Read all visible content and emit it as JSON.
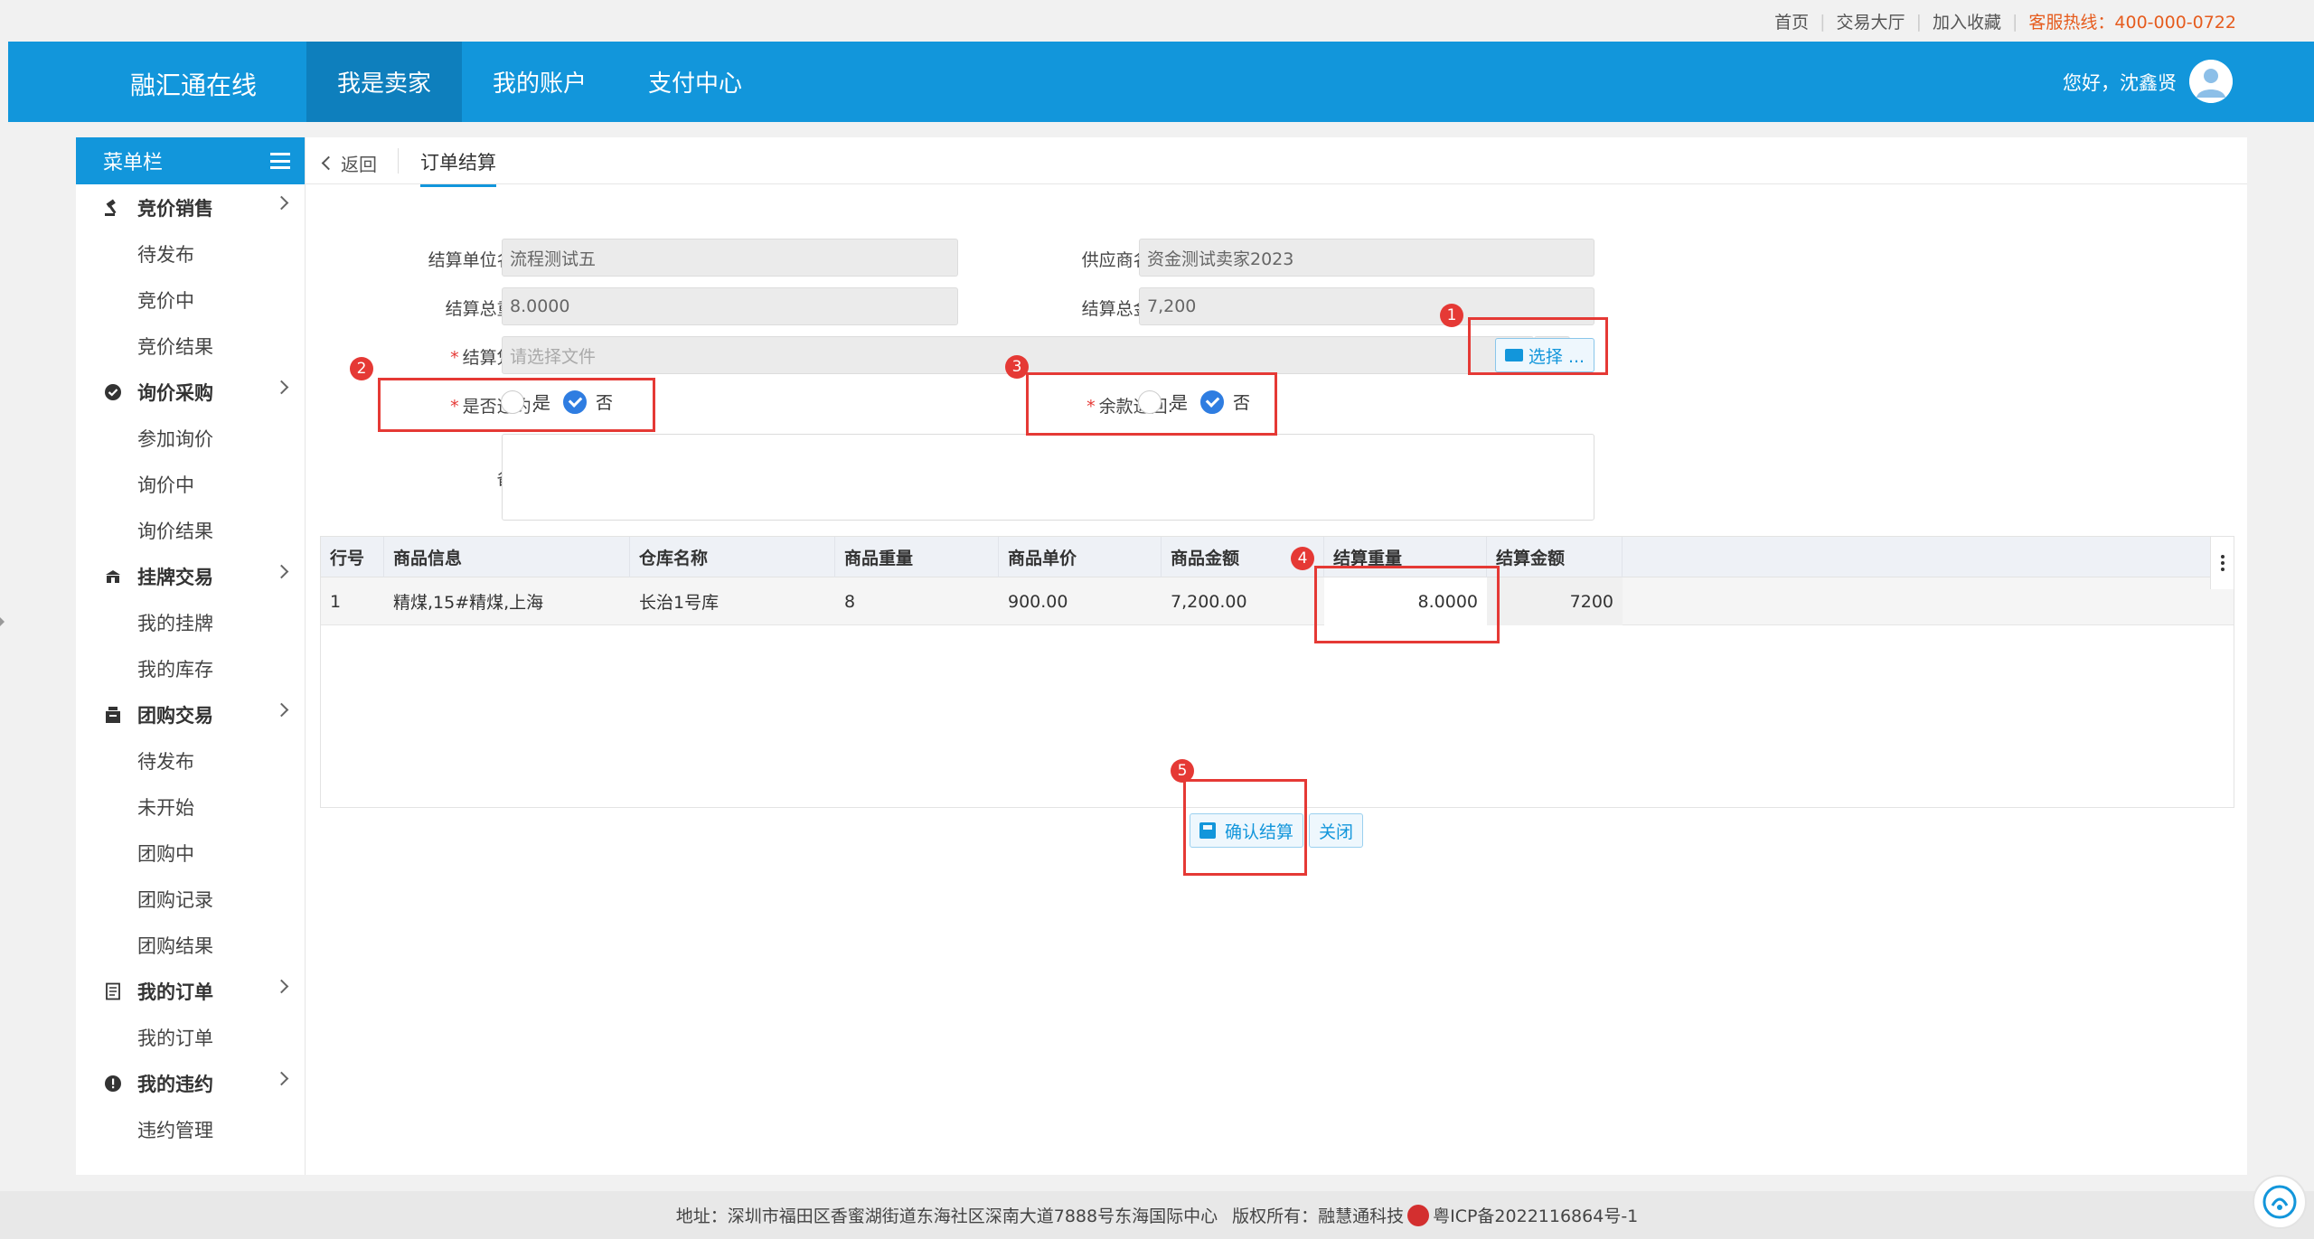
{
  "top_links": {
    "home": "首页",
    "hall": "交易大厅",
    "favorite": "加入收藏",
    "hotline": "客服热线：400-000-0722"
  },
  "header": {
    "brand": "融汇通在线",
    "tabs": [
      "我是卖家",
      "我的账户",
      "支付中心"
    ],
    "greeting": "您好，沈鑫贤"
  },
  "sidebar": {
    "title": "菜单栏",
    "groups": [
      {
        "label": "竞价销售",
        "icon": "gavel-icon",
        "items": [
          "待发布",
          "竞价中",
          "竞价结果"
        ]
      },
      {
        "label": "询价采购",
        "icon": "check-circle-icon",
        "items": [
          "参加询价",
          "询价中",
          "询价结果"
        ]
      },
      {
        "label": "挂牌交易",
        "icon": "listing-icon",
        "items": [
          "我的挂牌",
          "我的库存"
        ]
      },
      {
        "label": "团购交易",
        "icon": "group-buy-icon",
        "items": [
          "待发布",
          "未开始",
          "团购中",
          "团购记录",
          "团购结果"
        ]
      },
      {
        "label": "我的订单",
        "icon": "order-icon",
        "items": [
          "我的订单"
        ]
      },
      {
        "label": "我的违约",
        "icon": "alert-icon",
        "items": [
          "违约管理"
        ]
      }
    ]
  },
  "breadcrumb": {
    "back": "返回",
    "current": "订单结算"
  },
  "form": {
    "unit_name_label": "结算单位名称:",
    "unit_name_value": "流程测试五",
    "supplier_label": "供应商名称:",
    "supplier_value": "资金测试卖家2023",
    "total_weight_label": "结算总重量:",
    "total_weight_value": "8.0000",
    "total_amount_label": "结算总金额:",
    "total_amount_value": "7,200",
    "voucher_label": "结算凭证:",
    "voucher_placeholder": "请选择文件",
    "choose_button": "选择 ...",
    "breach_label": "是否违约:",
    "refund_label": "余款退回:",
    "yes": "是",
    "no": "否",
    "remark_label": "备注:"
  },
  "table": {
    "columns": [
      "行号",
      "商品信息",
      "仓库名称",
      "商品重量",
      "商品单价",
      "商品金额",
      "结算重量",
      "结算金额"
    ],
    "rows": [
      [
        "1",
        "精煤,15#精煤,上海",
        "长治1号库",
        "8",
        "900.00",
        "7,200.00",
        "8.0000",
        "7200"
      ]
    ]
  },
  "actions": {
    "confirm": "确认结算",
    "close": "关闭"
  },
  "annotations": [
    "1",
    "2",
    "3",
    "4",
    "5"
  ],
  "footer": {
    "address": "地址：深圳市福田区香蜜湖街道东海社区深南大道7888号东海国际中心",
    "copyright": "版权所有：融慧通科技",
    "icp": "粤ICP备2022116864号-1"
  },
  "colors": {
    "brand_blue": "#1296db",
    "highlight_red": "#e53935",
    "hotline_orange": "#e65c1e",
    "checked_blue": "#2f7de1"
  }
}
